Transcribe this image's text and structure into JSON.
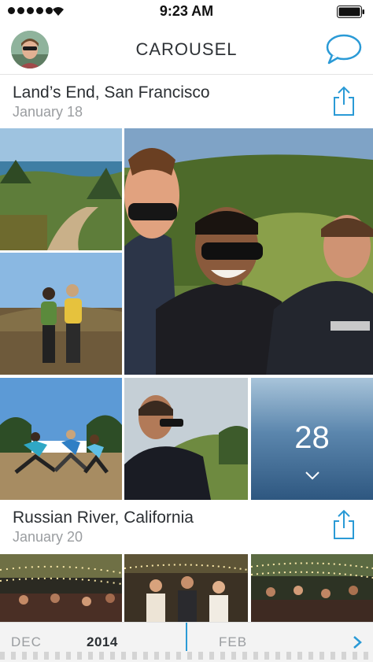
{
  "status_bar": {
    "time": "9:23 AM"
  },
  "nav": {
    "title": "CAROUSEL"
  },
  "sections": [
    {
      "title": "Land’s End, San Francisco",
      "date": "January 18"
    },
    {
      "title": "Russian River, California",
      "date": "January 20"
    }
  ],
  "more_tile": {
    "count": "28"
  },
  "timeline": {
    "prev_month": "DEC",
    "year": "2014",
    "next_month": "FEB"
  },
  "icons": {
    "chat": "chat-bubble-icon",
    "share": "share-icon",
    "chevron_down": "chevron-down-icon",
    "chevron_right": "chevron-right-icon"
  },
  "colors": {
    "accent": "#2a9ad6",
    "text_dark": "#2b2f33",
    "text_muted": "#9a9da0"
  }
}
